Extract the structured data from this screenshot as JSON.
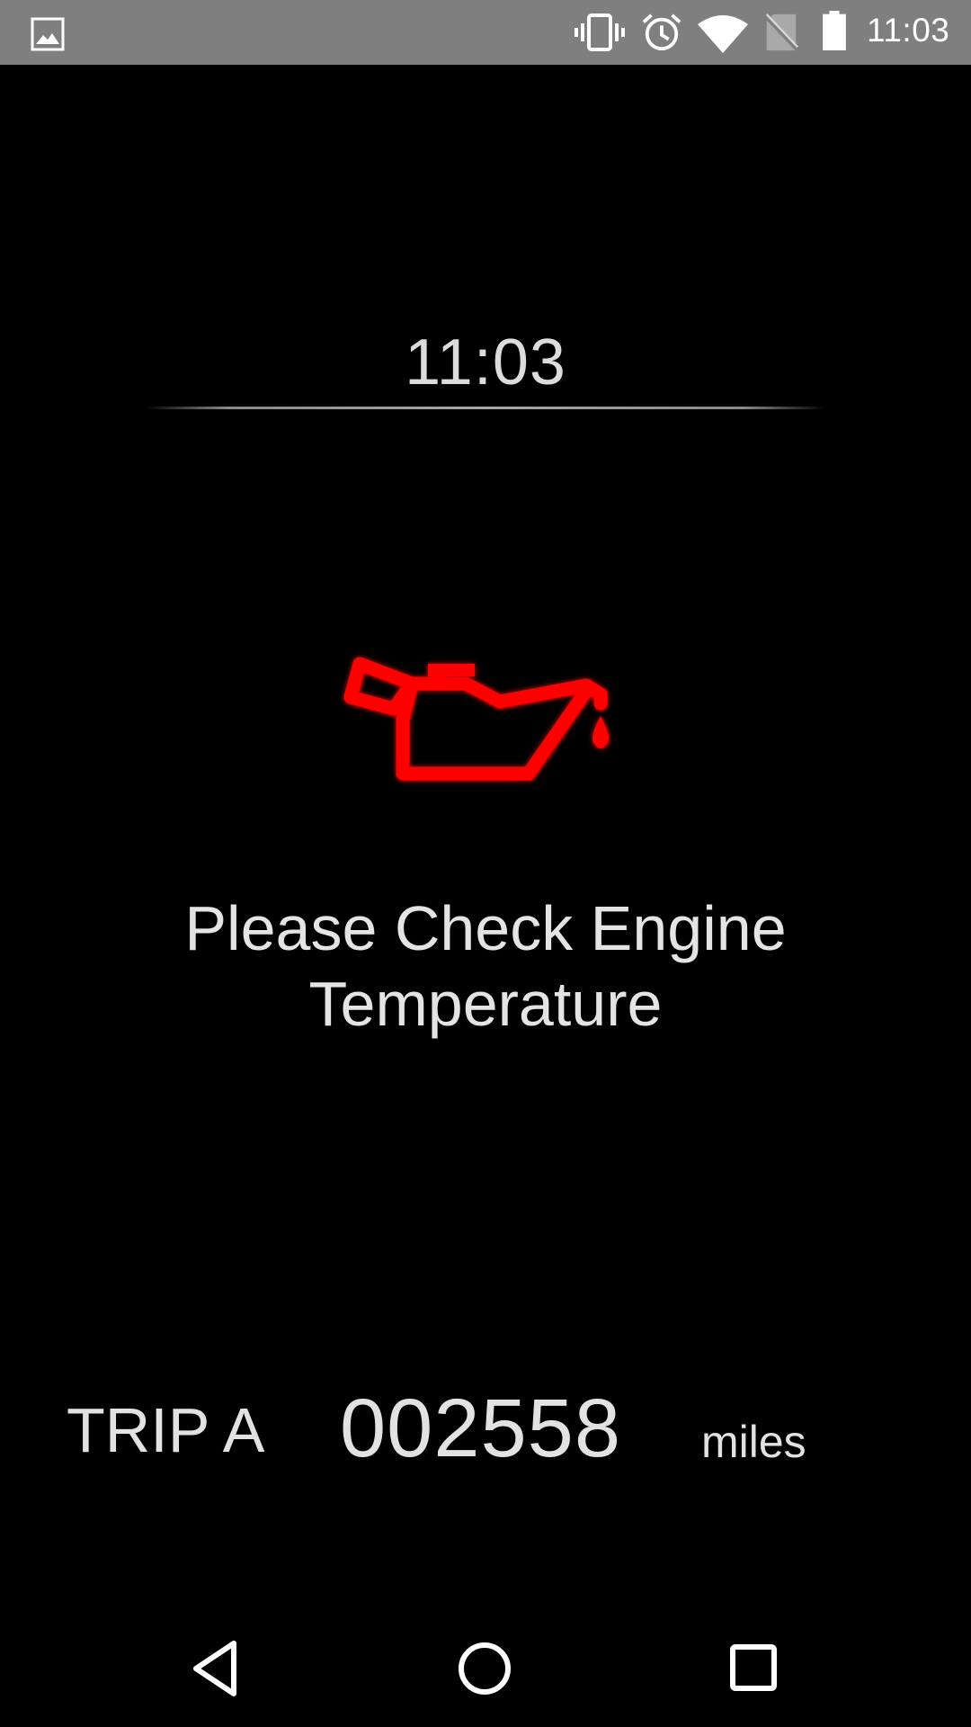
{
  "status_bar": {
    "time": "11:03",
    "icons": [
      "image-notification-icon",
      "vibrate-icon",
      "alarm-icon",
      "wifi-icon",
      "no-sim-icon",
      "battery-icon"
    ],
    "background_color": "#7f7f7f"
  },
  "clock": {
    "time": "11:03"
  },
  "warning": {
    "icon": "oil-can-icon",
    "icon_color": "#ff0000",
    "message_line1": "Please Check Engine",
    "message_line2": "Temperature"
  },
  "trip": {
    "label": "TRIP A",
    "value": "002558",
    "unit": "miles"
  },
  "nav_bar": {
    "buttons": [
      "back-icon",
      "home-icon",
      "recents-icon"
    ]
  }
}
